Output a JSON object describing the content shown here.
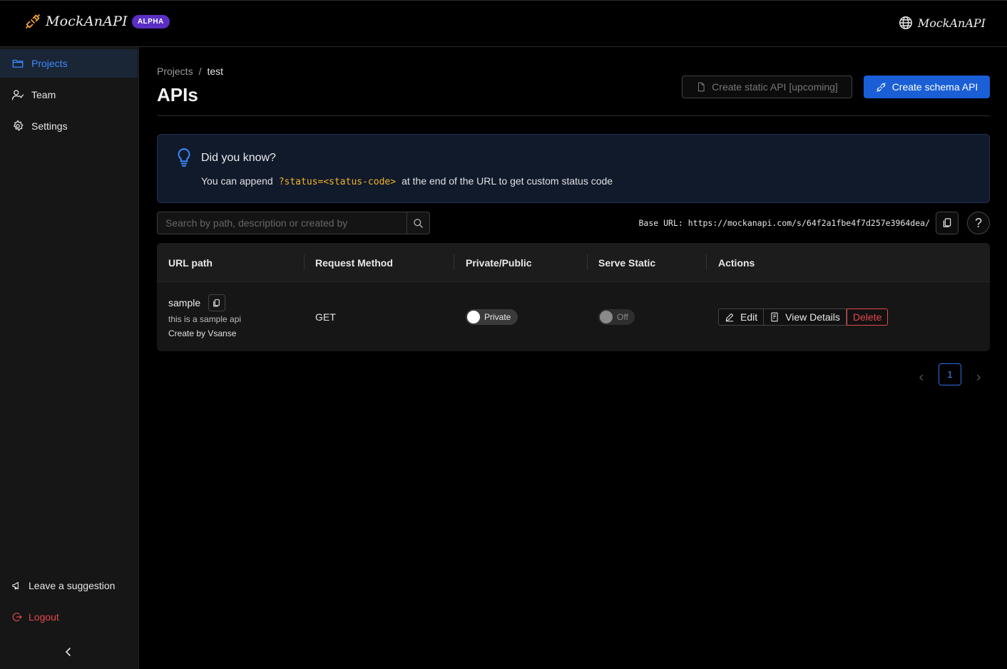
{
  "app": {
    "name": "MockAnAPI",
    "badge": "ALPHA",
    "top_right_label": "MockAnAPI"
  },
  "colors": {
    "accent": "#1a5fd6",
    "link_active": "#3d8bfd",
    "danger": "#e5484d",
    "code": "#f0b429",
    "badge": "#5b2fc4"
  },
  "sidebar": {
    "items": [
      {
        "label": "Projects",
        "icon": "folder-icon",
        "active": true
      },
      {
        "label": "Team",
        "icon": "team-icon",
        "active": false
      },
      {
        "label": "Settings",
        "icon": "gear-icon",
        "active": false
      }
    ],
    "bottom": [
      {
        "label": "Leave a suggestion",
        "icon": "megaphone-icon"
      },
      {
        "label": "Logout",
        "icon": "logout-icon"
      }
    ]
  },
  "breadcrumb": {
    "root": "Projects",
    "separator": "/",
    "current": "test"
  },
  "page": {
    "title": "APIs",
    "create_static_label": "Create static API [upcoming]",
    "create_schema_label": "Create schema API"
  },
  "tip": {
    "title": "Did you know?",
    "prefix": "You can append",
    "code": "?status=<status-code>",
    "suffix": "at the end of the URL to get custom status code"
  },
  "search": {
    "placeholder": "Search by path, description or created by",
    "value": ""
  },
  "base_url": {
    "label": "Base URL:",
    "value": "https://mockanapi.com/s/64f2a1fbe4f7d257e3964dea/"
  },
  "help_label": "?",
  "table": {
    "columns": [
      "URL path",
      "Request Method",
      "Private/Public",
      "Serve Static",
      "Actions"
    ],
    "rows": [
      {
        "path": "sample",
        "description": "this is a sample api",
        "created_by": "Create by Vsanse",
        "method": "GET",
        "visibility": "Private",
        "serve_static": "Off",
        "actions": {
          "edit": "Edit",
          "view": "View Details",
          "delete": "Delete"
        }
      }
    ]
  },
  "pagination": {
    "current_page": "1"
  }
}
